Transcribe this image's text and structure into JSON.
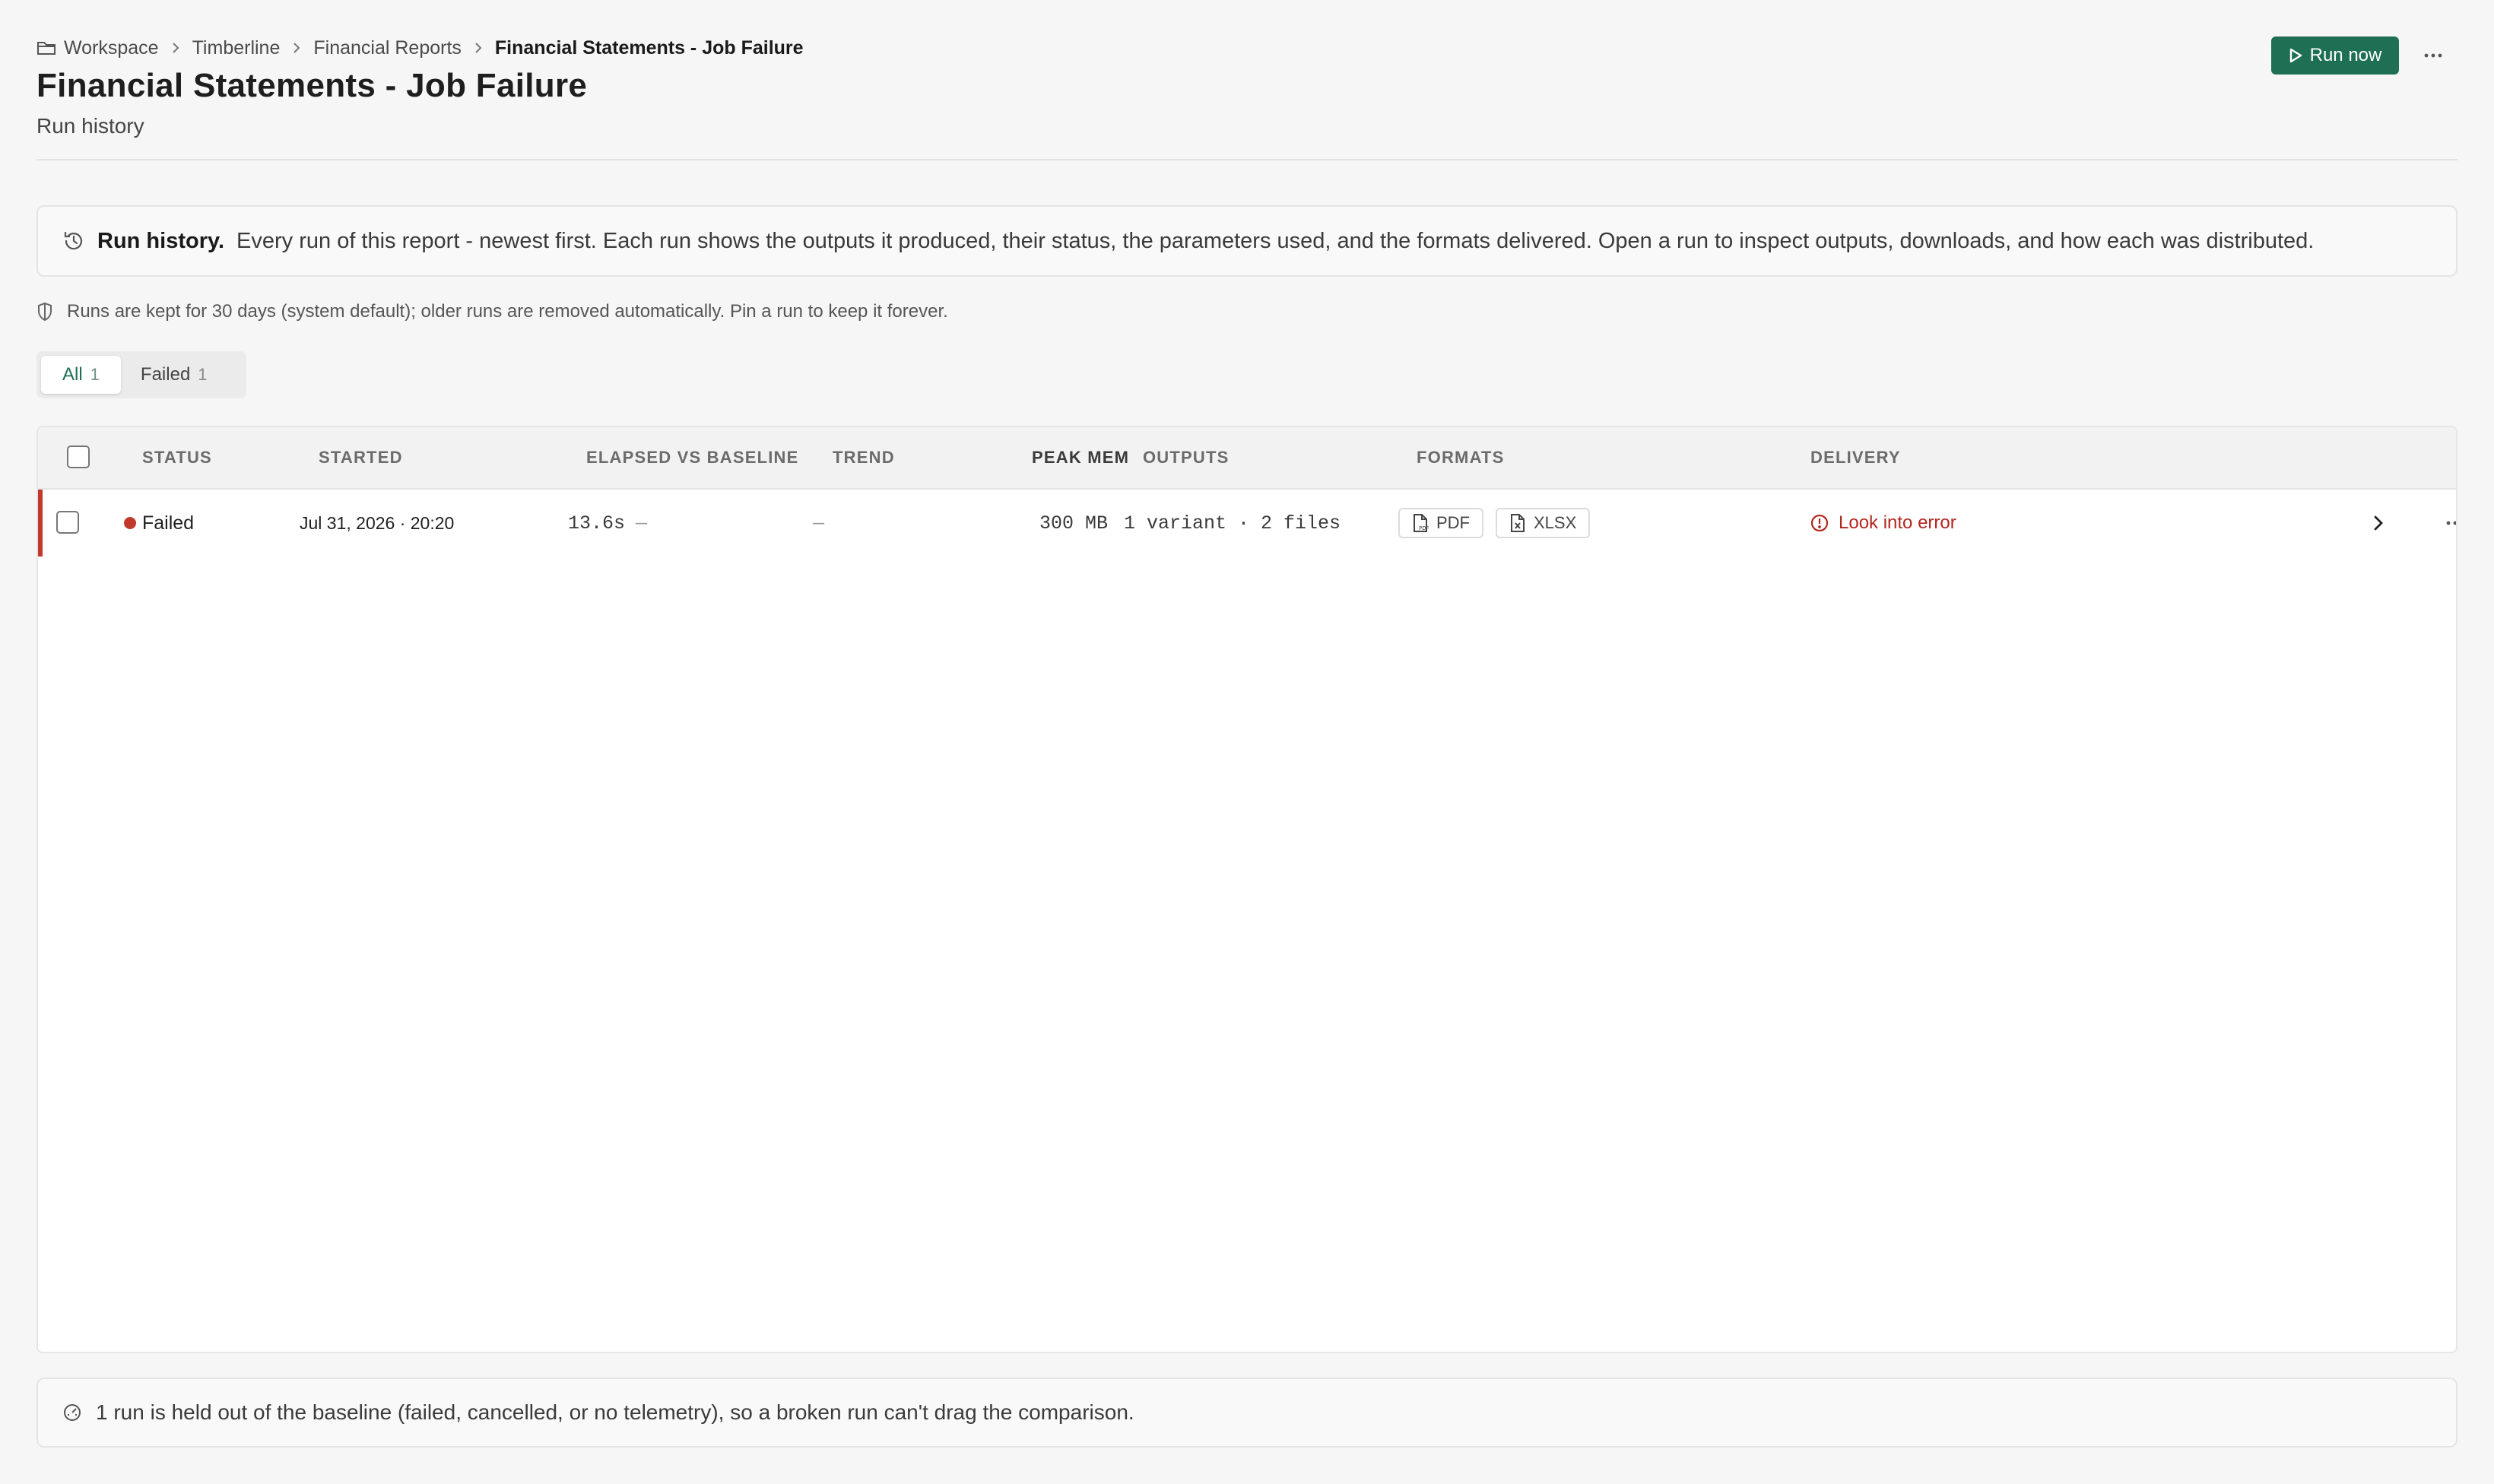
{
  "breadcrumb": {
    "items": [
      "Workspace",
      "Timberline",
      "Financial Reports",
      "Financial Statements - Job Failure"
    ]
  },
  "header": {
    "title": "Financial Statements - Job Failure",
    "subtitle": "Run history",
    "run_now_label": "Run now"
  },
  "info_banner": {
    "title": "Run history.",
    "text": "Every run of this report - newest first. Each run shows the outputs it produced, their status, the parameters used, and the formats delivered. Open a run to inspect outputs, downloads, and how each was distributed."
  },
  "retention_note": "Runs are kept for 30 days (system default); older runs are removed automatically. Pin a run to keep it forever.",
  "filters": [
    {
      "label": "All",
      "count": "1",
      "active": true
    },
    {
      "label": "Failed",
      "count": "1",
      "active": false
    }
  ],
  "table": {
    "columns": {
      "status": "STATUS",
      "started": "STARTED",
      "elapsed": "ELAPSED VS BASELINE",
      "trend": "TREND",
      "peak_mem": "PEAK MEM",
      "outputs": "OUTPUTS",
      "formats": "FORMATS",
      "delivery": "DELIVERY"
    },
    "rows": [
      {
        "status": "Failed",
        "status_color": "#c0392b",
        "started": "Jul 31, 2026 · 20:20",
        "elapsed": "13.6s",
        "baseline": "—",
        "trend": "—",
        "peak_mem": "300 MB",
        "outputs": "1 variant · 2 files",
        "formats": [
          "PDF",
          "XLSX"
        ],
        "delivery": "Look into error"
      }
    ]
  },
  "footer_note": "1 run is held out of the baseline (failed, cancelled, or no telemetry), so a broken run can't drag the comparison.",
  "colors": {
    "accent": "#1f6f55",
    "error": "#b3261e",
    "failed_dot": "#c0392b"
  },
  "icons": [
    "folder-icon",
    "chevron-right-icon",
    "play-icon",
    "more-horizontal-icon",
    "history-icon",
    "shield-icon",
    "pdf-file-icon",
    "xlsx-file-icon",
    "alert-circle-icon",
    "gauge-icon"
  ]
}
